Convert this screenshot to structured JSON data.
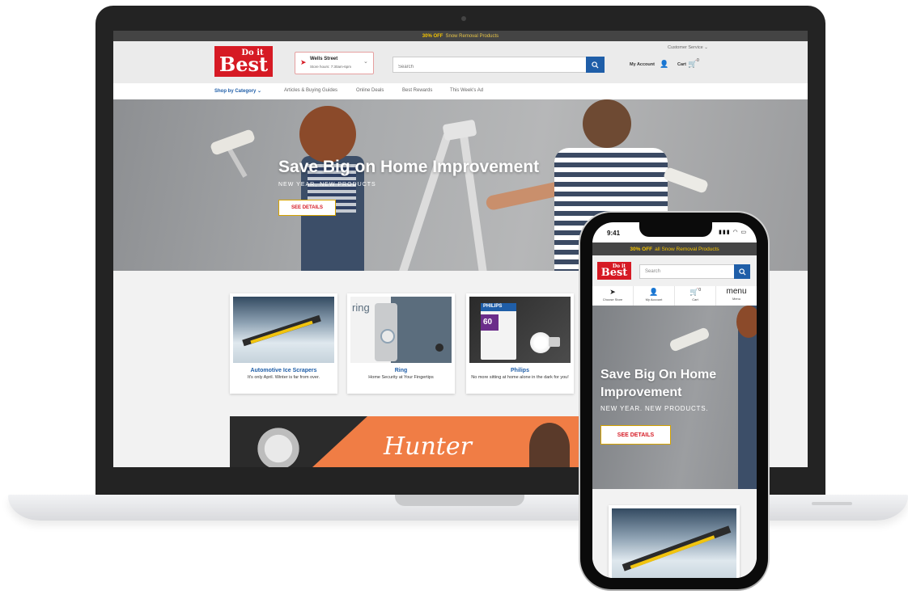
{
  "desktop": {
    "promo": {
      "bold": "30% OFF",
      "rest": "Snow Removal Products"
    },
    "header": {
      "customer_service": "Customer Service ⌄",
      "logo": {
        "line1": "Do it",
        "line2": "Best"
      },
      "store": {
        "name": "Wells Street",
        "hours": "Store hours: 7:30am-6pm"
      },
      "search_placeholder": "Search",
      "my_account": "My Account",
      "cart": "Cart",
      "cart_count": "0"
    },
    "nav": {
      "shop_by_category": "Shop by Category ⌄",
      "items": [
        "Articles & Buying Guides",
        "Online Deals",
        "Best Rewards",
        "This Week's Ad"
      ]
    },
    "hero": {
      "title": "Save Big on Home Improvement",
      "subtitle": "NEW YEAR, NEW PRODUCTS",
      "button": "SEE DETAILS"
    },
    "tiles": [
      {
        "title": "Automotive Ice Scrapers",
        "desc": "It's only April. Winter is far from over."
      },
      {
        "title": "Ring",
        "desc": "Home Security at Your Fingertips",
        "img_text": "ring"
      },
      {
        "title": "Philips",
        "desc": "No more sitting at home alone in the dark for you!",
        "img_text": "PHILIPS",
        "img_watt": "60"
      }
    ],
    "banner": {
      "brand": "Hunter"
    }
  },
  "mobile": {
    "status_time": "9:41",
    "promo": {
      "bold": "30% OFF",
      "rest": "all Snow Removal Products"
    },
    "logo": {
      "line1": "Do it",
      "line2": "Best"
    },
    "search_placeholder": "Search",
    "tabs": [
      {
        "icon": "➤",
        "label": "Choose Store"
      },
      {
        "icon": "👤",
        "label": "My Account"
      },
      {
        "icon": "🛒",
        "label": "Cart",
        "count": "0"
      },
      {
        "icon_text": "menu",
        "label": "Menu"
      }
    ],
    "hero": {
      "title": "Save Big On Home Improvement",
      "subtitle": "NEW YEAR. NEW PRODUCTS.",
      "button": "SEE DETAILS"
    }
  },
  "colors": {
    "brand_red": "#d61a24",
    "brand_blue": "#1f5ea8",
    "promo_yellow": "#f5c400",
    "hunter_orange": "#f07d45"
  }
}
